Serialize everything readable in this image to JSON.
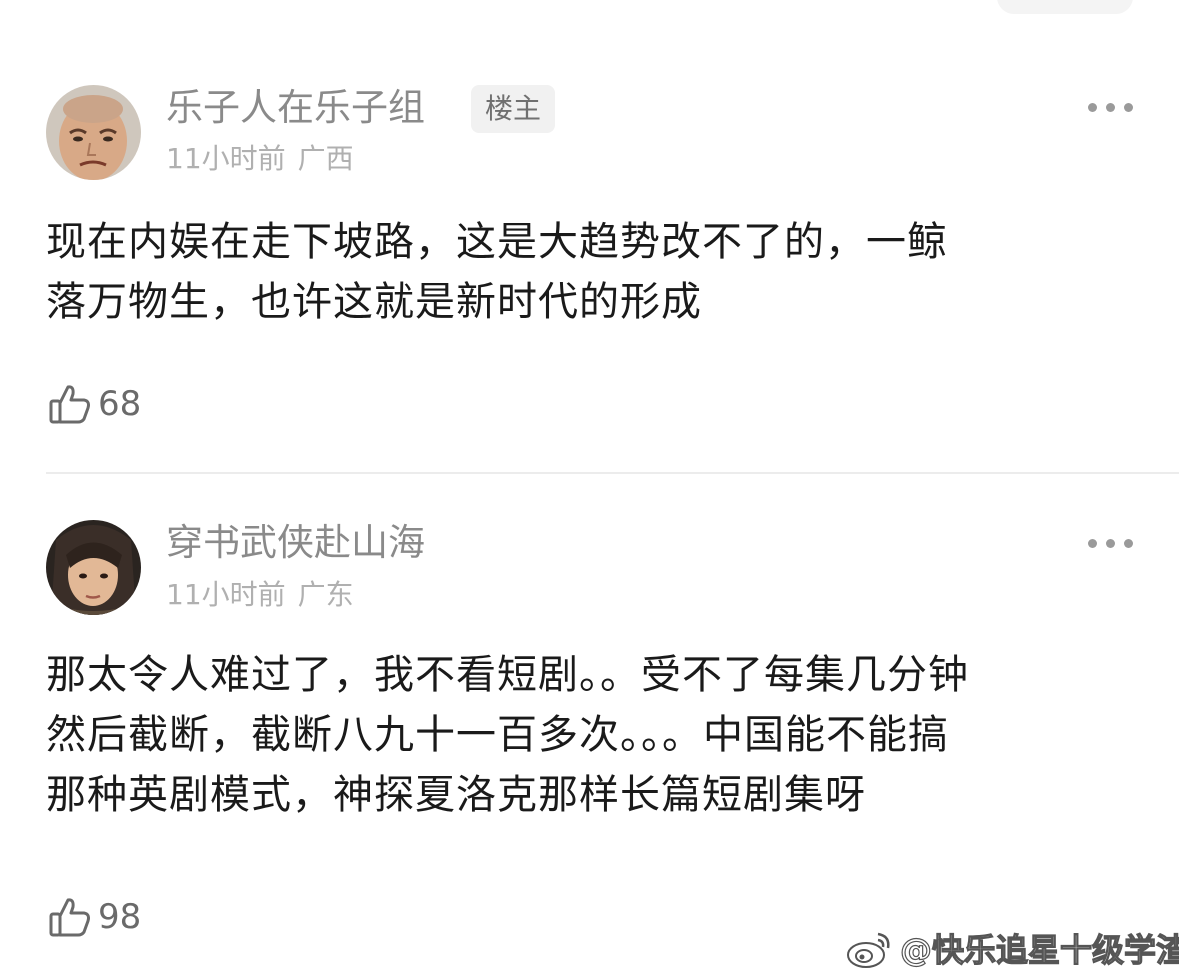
{
  "comments": [
    {
      "username": "乐子人在乐子组",
      "badge": "楼主",
      "time": "11小时前",
      "location": "广西",
      "content_line1": "现在内娱在走下坡路，这是大趋势改不了的，一鲸",
      "content_line2": "落万物生，也许这就是新时代的形成",
      "likes": "68"
    },
    {
      "username": "穿书武侠赴山海",
      "time": "11小时前",
      "location": "广东",
      "content_line1": "那太令人难过了，我不看短剧。。受不了每集几分钟",
      "content_line2": "然后截断，截断八九十一百多次。。。中国能不能搞",
      "content_line3": "那种英剧模式，神探夏洛克那样长篇短剧集呀",
      "likes": "98"
    }
  ],
  "icons": {
    "like": "thumbs-up-icon",
    "more": "more-options-icon",
    "watermark": "weibo-logo-icon"
  },
  "watermark": {
    "text": "@快乐追星十级学渣"
  },
  "colors": {
    "text_primary": "#1a1a1a",
    "text_secondary": "#8a8a8a",
    "text_meta": "#b0b0b0",
    "badge_bg": "#f1f1f1",
    "divider": "#ececec"
  }
}
